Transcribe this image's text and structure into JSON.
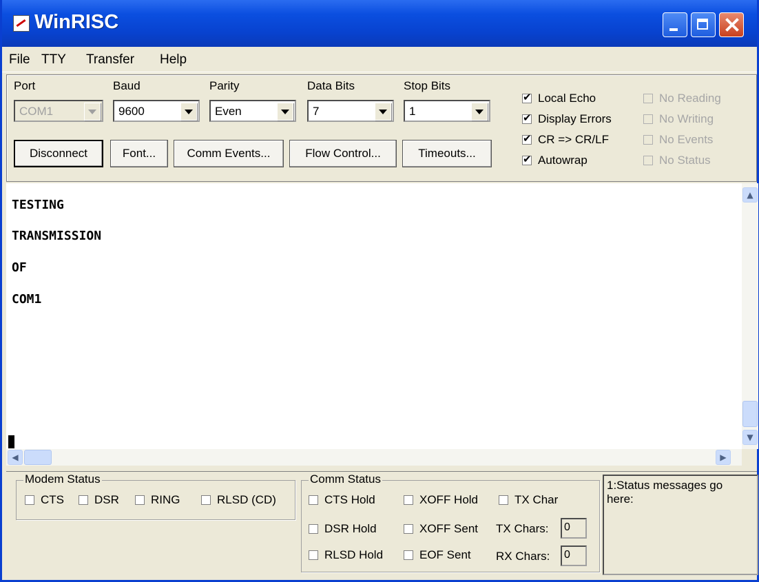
{
  "window": {
    "title": "WinRISC"
  },
  "menu": {
    "file": "File",
    "tty": "TTY",
    "transfer": "Transfer",
    "help": "Help"
  },
  "settings": {
    "port": {
      "label": "Port",
      "value": "COM1"
    },
    "baud": {
      "label": "Baud",
      "value": "9600"
    },
    "parity": {
      "label": "Parity",
      "value": "Even"
    },
    "data_bits": {
      "label": "Data Bits",
      "value": "7"
    },
    "stop_bits": {
      "label": "Stop Bits",
      "value": "1"
    }
  },
  "buttons": {
    "disconnect": "Disconnect",
    "font": "Font...",
    "comm_events": "Comm Events...",
    "flow_control": "Flow Control...",
    "timeouts": "Timeouts..."
  },
  "options": {
    "local_echo": {
      "label": "Local Echo",
      "checked": true
    },
    "display_errors": {
      "label": "Display Errors",
      "checked": true
    },
    "cr_crlf": {
      "label": "CR => CR/LF",
      "checked": true
    },
    "autowrap": {
      "label": "Autowrap",
      "checked": true
    },
    "no_reading": {
      "label": "No Reading",
      "checked": false
    },
    "no_writing": {
      "label": "No Writing",
      "checked": false
    },
    "no_events": {
      "label": "No Events",
      "checked": false
    },
    "no_status": {
      "label": "No Status",
      "checked": false
    }
  },
  "terminal": {
    "lines": [
      "TESTING",
      "TRANSMISSION",
      "OF",
      "COM1"
    ]
  },
  "modem_status": {
    "title": "Modem Status",
    "cts": "CTS",
    "dsr": "DSR",
    "ring": "RING",
    "rlsd": "RLSD (CD)"
  },
  "comm_status": {
    "title": "Comm Status",
    "cts_hold": "CTS Hold",
    "dsr_hold": "DSR Hold",
    "rlsd_hold": "RLSD Hold",
    "xoff_hold": "XOFF Hold",
    "xoff_sent": "XOFF Sent",
    "eof_sent": "EOF Sent",
    "tx_char": "TX Char",
    "tx_chars_label": "TX Chars:",
    "tx_chars_value": "0",
    "rx_chars_label": "RX Chars:",
    "rx_chars_value": "0"
  },
  "status_message": "1:Status messages go here:"
}
